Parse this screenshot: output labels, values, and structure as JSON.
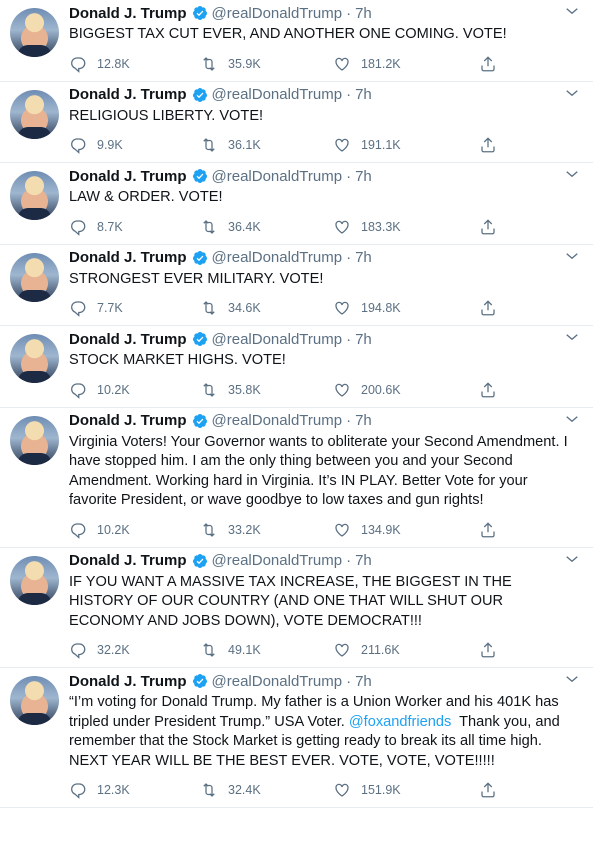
{
  "tweets": [
    {
      "name": "Donald J. Trump",
      "handle": "@realDonaldTrump",
      "time": "7h",
      "text": "BIGGEST TAX CUT EVER, AND ANOTHER ONE COMING. VOTE!",
      "replies": "12.8K",
      "retweets": "35.9K",
      "likes": "181.2K"
    },
    {
      "name": "Donald J. Trump",
      "handle": "@realDonaldTrump",
      "time": "7h",
      "text": "RELIGIOUS LIBERTY. VOTE!",
      "replies": "9.9K",
      "retweets": "36.1K",
      "likes": "191.1K"
    },
    {
      "name": "Donald J. Trump",
      "handle": "@realDonaldTrump",
      "time": "7h",
      "text": "LAW & ORDER. VOTE!",
      "replies": "8.7K",
      "retweets": "36.4K",
      "likes": "183.3K"
    },
    {
      "name": "Donald J. Trump",
      "handle": "@realDonaldTrump",
      "time": "7h",
      "text": "STRONGEST EVER MILITARY. VOTE!",
      "replies": "7.7K",
      "retweets": "34.6K",
      "likes": "194.8K"
    },
    {
      "name": "Donald J. Trump",
      "handle": "@realDonaldTrump",
      "time": "7h",
      "text": "STOCK MARKET HIGHS. VOTE!",
      "replies": "10.2K",
      "retweets": "35.8K",
      "likes": "200.6K"
    },
    {
      "name": "Donald J. Trump",
      "handle": "@realDonaldTrump",
      "time": "7h",
      "text": "Virginia Voters! Your Governor wants to obliterate your Second Amendment. I have stopped him. I am the only thing between you and your Second Amendment. Working hard in Virginia. It’s IN PLAY. Better Vote for your favorite President, or wave goodbye to low taxes and gun rights!",
      "replies": "10.2K",
      "retweets": "33.2K",
      "likes": "134.9K"
    },
    {
      "name": "Donald J. Trump",
      "handle": "@realDonaldTrump",
      "time": "7h",
      "text": "IF YOU WANT A MASSIVE TAX INCREASE, THE BIGGEST IN THE HISTORY OF OUR COUNTRY (AND ONE THAT WILL SHUT OUR ECONOMY AND JOBS DOWN), VOTE DEMOCRAT!!!",
      "replies": "32.2K",
      "retweets": "49.1K",
      "likes": "211.6K"
    },
    {
      "name": "Donald J. Trump",
      "handle": "@realDonaldTrump",
      "time": "7h",
      "text": "“I’m voting for Donald Trump. My father is a Union Worker and his 401K has tripled under President Trump.” USA Voter. ",
      "mention": "@foxandfriends",
      "text_after": "  Thank you, and remember that the Stock Market is getting ready to break its all time high. NEXT YEAR WILL BE THE BEST EVER. VOTE, VOTE, VOTE!!!!!",
      "replies": "12.3K",
      "retweets": "32.4K",
      "likes": "151.9K"
    }
  ],
  "colors": {
    "accent": "#1da1f2",
    "muted": "#5b7083",
    "border": "#e6ecf0"
  },
  "icons": {
    "reply": "reply-icon",
    "retweet": "retweet-icon",
    "like": "heart-icon",
    "share": "share-icon",
    "verified": "verified-badge-icon",
    "menu": "chevron-down-icon"
  }
}
